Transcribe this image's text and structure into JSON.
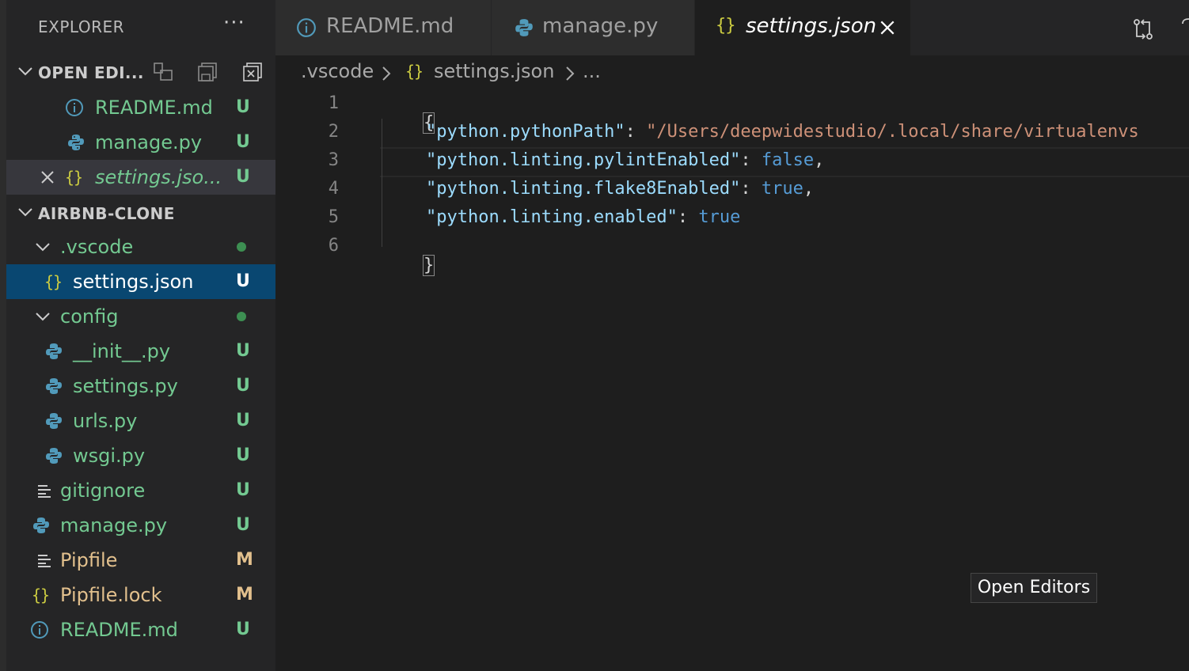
{
  "explorer": {
    "title": "EXPLORER",
    "more": "···",
    "open_editors": {
      "title": "OPEN EDI...",
      "items": [
        {
          "label": "README.md",
          "badge": "U"
        },
        {
          "label": "manage.py",
          "badge": "U"
        },
        {
          "label": "settings.jso...",
          "badge": "U"
        }
      ]
    },
    "project": {
      "title": "AIRBNB-CLONE",
      "items": [
        {
          "label": ".vscode"
        },
        {
          "label": "settings.json",
          "badge": "U"
        },
        {
          "label": "config"
        },
        {
          "label": "__init__.py",
          "badge": "U"
        },
        {
          "label": "settings.py",
          "badge": "U"
        },
        {
          "label": "urls.py",
          "badge": "U"
        },
        {
          "label": "wsgi.py",
          "badge": "U"
        },
        {
          "label": "gitignore",
          "badge": "U"
        },
        {
          "label": "manage.py",
          "badge": "U"
        },
        {
          "label": "Pipfile",
          "badge": "M"
        },
        {
          "label": "Pipfile.lock",
          "badge": "M"
        },
        {
          "label": "README.md",
          "badge": "U"
        }
      ]
    }
  },
  "tabs": [
    {
      "label": "README.md",
      "icon": "info-icon"
    },
    {
      "label": "manage.py",
      "icon": "python-icon"
    },
    {
      "label": "settings.json",
      "icon": "json-icon",
      "active": true
    }
  ],
  "breadcrumb": {
    "folder": ".vscode",
    "file": "settings.json",
    "more": "..."
  },
  "editor": {
    "line_numbers": [
      "1",
      "2",
      "3",
      "4",
      "5",
      "6"
    ],
    "lines": [
      {
        "open": "{"
      },
      {
        "key": "\"python.pythonPath\"",
        "sep": ": ",
        "value": "\"/Users/deepwidestudio/.local/share/virtualenvs"
      },
      {
        "key": "\"python.linting.pylintEnabled\"",
        "sep": ": ",
        "value": "false",
        "end": ","
      },
      {
        "key": "\"python.linting.flake8Enabled\"",
        "sep": ": ",
        "value": "true",
        "end": ","
      },
      {
        "key": "\"python.linting.enabled\"",
        "sep": ": ",
        "value": "true"
      },
      {
        "close": "}"
      }
    ]
  },
  "tooltip": "Open Editors",
  "colors": {
    "untracked": "#73c991",
    "modified": "#e2c08d",
    "selection": "#094771",
    "json_icon": "#cbcb41",
    "python_icon": "#519aba"
  }
}
